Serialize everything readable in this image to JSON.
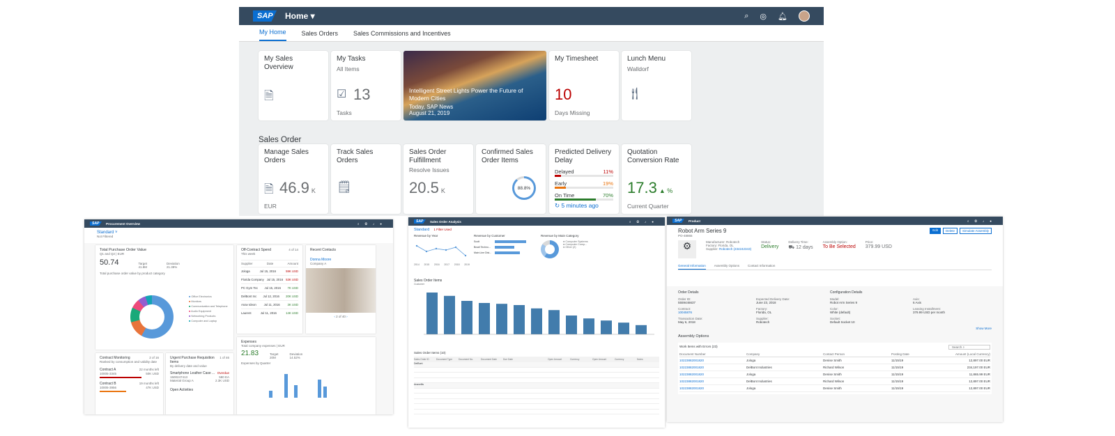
{
  "main": {
    "logo": "SAP",
    "home": "Home",
    "tabs": [
      "My Home",
      "Sales Orders",
      "Sales Commissions and Incentives"
    ],
    "tiles": {
      "sales_overview": {
        "title": "My Sales Overview"
      },
      "tasks": {
        "title": "My Tasks",
        "subtitle": "All Items",
        "value": "13",
        "footer": "Tasks"
      },
      "news": {
        "title": "Intelligent Street Lights Power the Future of Modern Cities",
        "source": "Today, SAP News",
        "date": "August 21, 2019"
      },
      "timesheet": {
        "title": "My Timesheet",
        "value": "10",
        "footer": "Days Missing"
      },
      "lunch": {
        "title": "Lunch Menu",
        "subtitle": "Walldorf"
      }
    },
    "section": "Sales Order",
    "sales_tiles": {
      "manage": {
        "title": "Manage Sales Orders",
        "value": "46.9",
        "unit": "K",
        "footer": "EUR"
      },
      "track": {
        "title": "Track Sales Orders"
      },
      "fulfill": {
        "title": "Sales Order Fulfillment",
        "subtitle": "Resolve Issues",
        "value": "20.5",
        "unit": "K"
      },
      "confirmed": {
        "title": "Confirmed Sales Order Items",
        "ring": "88.8%"
      },
      "delay": {
        "title": "Predicted Delivery Delay",
        "rows": [
          {
            "label": "Delayed",
            "value": "11%",
            "color": "#bb0000"
          },
          {
            "label": "Early",
            "value": "19%",
            "color": "#e9730c"
          },
          {
            "label": "On Time",
            "value": "70%",
            "color": "#2b7c2b"
          }
        ],
        "footer": "5 minutes ago"
      },
      "quote": {
        "title": "Quotation Conversion Rate",
        "value": "17.3",
        "unit": "%",
        "footer": "Current Quarter"
      }
    }
  },
  "procurement": {
    "app": "Procurement Overview",
    "variant": "Standard",
    "filter": "Not Filtered",
    "po": {
      "title": "Total Purchase Order Value",
      "sub": "Q1 and Q2 | EUR",
      "value": "50.74",
      "target_label": "Target",
      "target": "41.8M",
      "dev_label": "Deviation",
      "dev": "21.39%",
      "chart_label": "Total purchase order value by product category",
      "legend": [
        "Office Electronics",
        "Monitors",
        "Communication and Telephone",
        "Audio Equipment",
        "Networking Products",
        "Computer and Laptop"
      ],
      "slices": [
        "2.54M",
        "3.55M",
        "4.95M",
        "6.67M",
        "25.3M"
      ]
    },
    "spend": {
      "title": "Off-Contract Spend",
      "count": "4 of 14",
      "sub": "This week",
      "headers": [
        "Supplier",
        "Date",
        "Amount"
      ],
      "rows": [
        [
          "Jologa",
          "Jul 15, 2016",
          "59K USD"
        ],
        [
          "Florida Company",
          "Jul 15, 2016",
          "53K USD"
        ],
        [
          "PC Gym Tec",
          "Jul 15, 2016",
          "7K USD"
        ],
        [
          "DelBont Inc",
          "Jul 12, 2016",
          "20K USD"
        ],
        [
          "Anav Ideon",
          "Jul 11, 2016",
          "3K USD"
        ],
        [
          "Laurent",
          "Jul 11, 2016",
          "14K USD"
        ]
      ]
    },
    "contacts": {
      "title": "Recent Contacts",
      "name": "Donna Moore",
      "company": "Company A",
      "pager": "2 of 40"
    },
    "contract": {
      "title": "Contract Monitoring",
      "count": "2 of 16",
      "sub": "Ranked by consumption and validity date",
      "a": "Contract A",
      "a_meta": "22 months left",
      "a_id": "10005-3345",
      "a_val": "50K USD",
      "b": "Contract B",
      "b_meta": "19 months left",
      "b_id": "10005-3956",
      "b_val": "47K USD"
    },
    "urgent": {
      "title": "Urgent Purchase Requisition Items",
      "count": "1 of 46",
      "sub": "By delivery date and value",
      "item": "Smartphone Leather Case ...",
      "status": "Overdue",
      "id": "1500247413",
      "val": "580 EA",
      "group": "Material Group A",
      "val2": "2.3K USD",
      "open": "Open Activities"
    },
    "expenses": {
      "title": "Expenses",
      "sub": "Total company expenses | EUR",
      "value": "21.83",
      "target_label": "Target",
      "target": "20M",
      "dev_label": "Deviation",
      "dev": "14.52%",
      "chart": "Expenses by Quarter",
      "legend": [
        "Actual",
        "Budget"
      ]
    }
  },
  "salesanalysis": {
    "app": "Sales Order Analysis",
    "variant": "Standard",
    "filter": "1 Filter Used",
    "rev_year": "Revenue by Year",
    "rev_cust": "Revenue by Customer",
    "rev_cat": "Revenue by Main Category",
    "years": [
      "2014",
      "2015",
      "2016",
      "2017",
      "2018",
      "2019"
    ],
    "customers": [
      "Scott",
      "Brazil Techno...",
      "Main Line Dist..."
    ],
    "cats": [
      "Computer Systems",
      "Computer Comp...",
      "Other (2)"
    ],
    "items_title": "Sales Order Items",
    "customer_label": "Customer",
    "table_title": "Sales Order Items (10)",
    "headers": [
      "Sales Order ID",
      "Document Type",
      "Document No.",
      "Document Date",
      "Due Date",
      "",
      "Open Amount",
      "Currency",
      "Open Amount",
      "Currency",
      "Notes"
    ],
    "groups": [
      "DelBont",
      "Anavellis"
    ]
  },
  "product": {
    "app": "Product",
    "title": "Robot Arm Series 9",
    "id": "PO-48865",
    "buttons": [
      "Edit",
      "Delete",
      "Simulate Assembly"
    ],
    "manufacturer_l": "Manufacturer:",
    "manufacturer": "Robotech",
    "factory_l": "Factory:",
    "factory": "Florida, OL",
    "supplier_l": "Supplier:",
    "supplier": "Robotech (234242343)",
    "status_l": "Status:",
    "status": "Delivery",
    "delivery_l": "Delivery Time:",
    "delivery": "12 days",
    "assembly_l": "Assembly Option:",
    "assembly": "To Be Selected",
    "price_l": "Price:",
    "price": "379.99 USD",
    "tabs": [
      "General Information",
      "Assembly Options",
      "Contact Information"
    ],
    "order_h": "Order Details",
    "config_h": "Configuration Details",
    "fields": [
      [
        "Order ID:",
        "5559446637"
      ],
      [
        "Expected Delivery Date:",
        "June 23, 2018"
      ],
      [
        "Contract:",
        "10045876"
      ],
      [
        "Factory:",
        "Florida, OL"
      ],
      [
        "Transaction Date:",
        "May 6, 2018"
      ],
      [
        "Supplier:",
        "Robotech"
      ]
    ],
    "cfg": [
      [
        "Model:",
        "Robot Arm Series 9"
      ],
      [
        "Axis:",
        "6 Axis"
      ],
      [
        "Color:",
        "White (default)"
      ],
      [
        "Leasing Installment:",
        "379.99 USD per month"
      ],
      [
        "Socket:",
        "Default Socket 10"
      ]
    ],
    "more": "Show More",
    "assembly_h": "Assembly Options",
    "errors_h": "Work Items with Errors (23)",
    "search": "Search",
    "cols": [
      "Document Number",
      "Company",
      "Contact Person",
      "Posting Date",
      "Amount (Local Currency)"
    ],
    "rows": [
      [
        "10223882001820",
        "Jologa",
        "Denise Smith",
        "11/15/19",
        "12,897.00 EUR"
      ],
      [
        "10223882001820",
        "DelBont Industries",
        "Richard Wilson",
        "11/15/19",
        "234,197.00 EUR"
      ],
      [
        "10223882001820",
        "Jologa",
        "Denise Smith",
        "11/15/19",
        "11,865.99 EUR"
      ],
      [
        "10223882001820",
        "DelBont Industries",
        "Richard Wilson",
        "11/15/19",
        "12,897.00 EUR"
      ],
      [
        "10223882001820",
        "Jologa",
        "Denise Smith",
        "11/15/19",
        "12,897.00 EUR"
      ]
    ]
  }
}
